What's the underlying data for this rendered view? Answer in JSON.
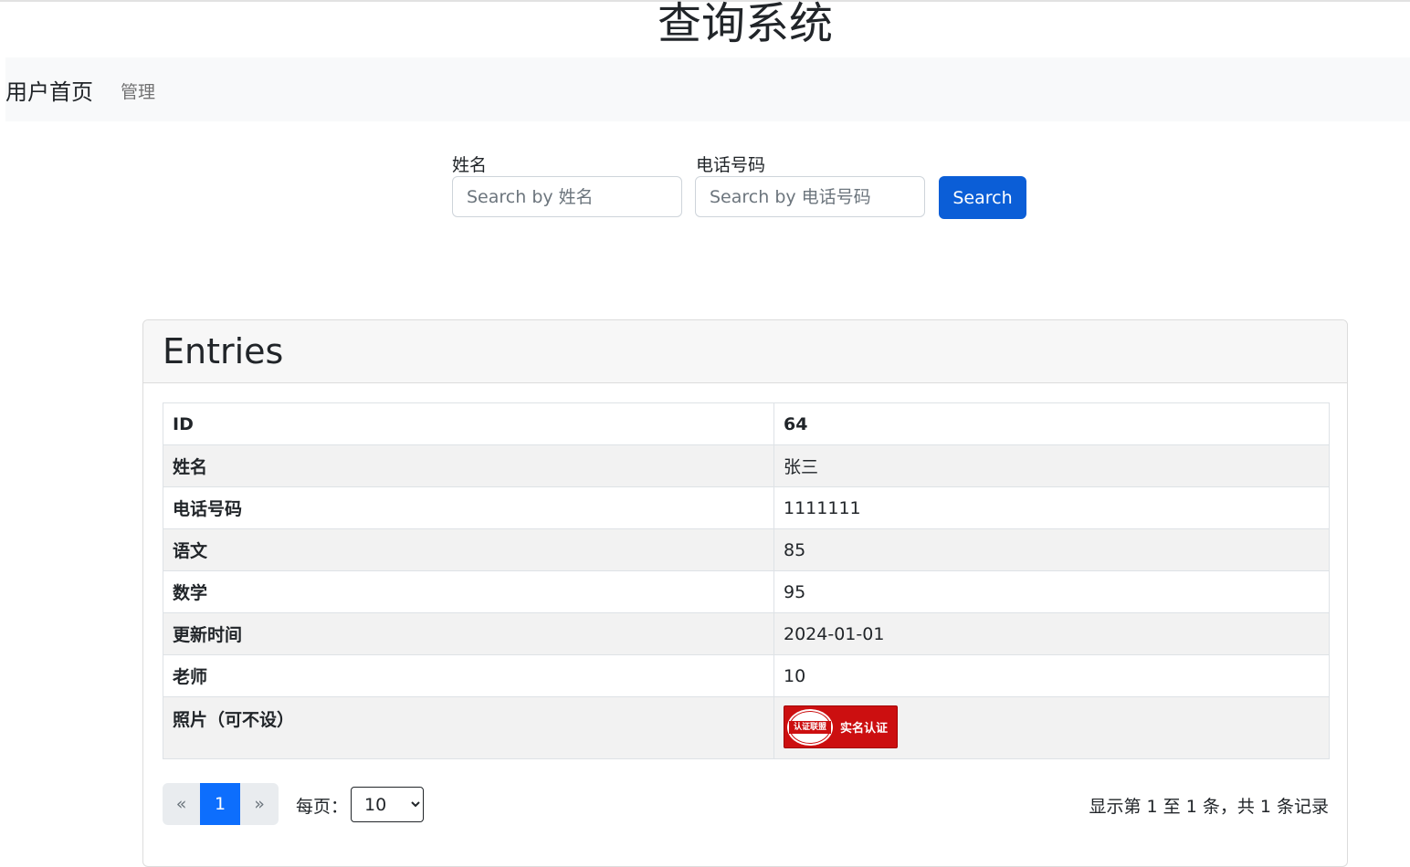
{
  "header": {
    "title": "查询系统"
  },
  "nav": {
    "brand": "用户首页",
    "items": [
      {
        "label": "管理"
      }
    ]
  },
  "search": {
    "name_label": "姓名",
    "name_placeholder": "Search by 姓名",
    "phone_label": "电话号码",
    "phone_placeholder": "Search by 电话号码",
    "button_label": "Search"
  },
  "card": {
    "title": "Entries",
    "rows": [
      {
        "key": "ID",
        "value": "64"
      },
      {
        "key": "姓名",
        "value": "张三"
      },
      {
        "key": "电话号码",
        "value": "1111111"
      },
      {
        "key": "语文",
        "value": "85"
      },
      {
        "key": "数学",
        "value": "95"
      },
      {
        "key": "更新时间",
        "value": "2024-01-01"
      },
      {
        "key": "老师",
        "value": "10"
      },
      {
        "key": "照片（可不设）",
        "value": ""
      }
    ],
    "photo": {
      "seal_text": "认证联盟",
      "badge_text": "实名认证"
    }
  },
  "pagination": {
    "prev": "«",
    "current": "1",
    "next": "»",
    "per_page_label": "每页：",
    "per_page_value": "10",
    "records_info": "显示第 1 至 1 条，共 1 条记录"
  },
  "colors": {
    "primary": "#0b5ed7",
    "active_page": "#0d6efd",
    "navbar_bg": "#f8f9fa"
  }
}
